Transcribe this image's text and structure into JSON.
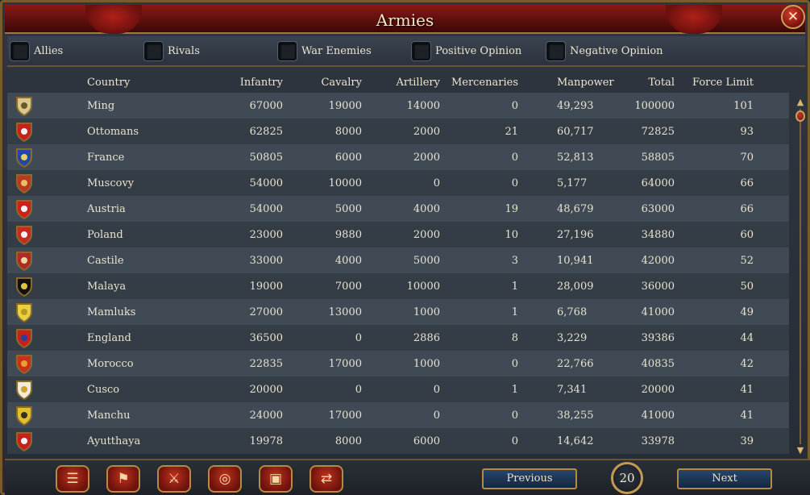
{
  "window": {
    "title": "Armies",
    "close_label": "✕"
  },
  "filters": [
    {
      "label": "Allies"
    },
    {
      "label": "Rivals"
    },
    {
      "label": "War Enemies"
    },
    {
      "label": "Positive Opinion"
    },
    {
      "label": "Negative Opinion"
    }
  ],
  "columns": [
    "Country",
    "Infantry",
    "Cavalry",
    "Artillery",
    "Mercenaries",
    "Manpower",
    "Total",
    "Force Limit"
  ],
  "rows": [
    {
      "country": "Ming",
      "infantry": "67000",
      "cavalry": "19000",
      "artillery": "14000",
      "mercenaries": "0",
      "manpower": "49,293",
      "total": "100000",
      "force_limit": "101",
      "flag": [
        "#d8c890",
        "#6a5a2a"
      ]
    },
    {
      "country": "Ottomans",
      "infantry": "62825",
      "cavalry": "8000",
      "artillery": "2000",
      "mercenaries": "21",
      "manpower": "60,717",
      "total": "72825",
      "force_limit": "93",
      "flag": [
        "#c8201c",
        "#f0f0f0"
      ]
    },
    {
      "country": "France",
      "infantry": "50805",
      "cavalry": "6000",
      "artillery": "2000",
      "mercenaries": "0",
      "manpower": "52,813",
      "total": "58805",
      "force_limit": "70",
      "flag": [
        "#2446a8",
        "#e8d060"
      ]
    },
    {
      "country": "Muscovy",
      "infantry": "54000",
      "cavalry": "10000",
      "artillery": "0",
      "mercenaries": "0",
      "manpower": "5,177",
      "total": "64000",
      "force_limit": "66",
      "flag": [
        "#b83a22",
        "#e8c060"
      ]
    },
    {
      "country": "Austria",
      "infantry": "54000",
      "cavalry": "5000",
      "artillery": "4000",
      "mercenaries": "19",
      "manpower": "48,679",
      "total": "63000",
      "force_limit": "66",
      "flag": [
        "#d0201c",
        "#f4f4f4"
      ]
    },
    {
      "country": "Poland",
      "infantry": "23000",
      "cavalry": "9880",
      "artillery": "2000",
      "mercenaries": "10",
      "manpower": "27,196",
      "total": "34880",
      "force_limit": "60",
      "flag": [
        "#c82a22",
        "#f4f4f4"
      ]
    },
    {
      "country": "Castile",
      "infantry": "33000",
      "cavalry": "4000",
      "artillery": "5000",
      "mercenaries": "3",
      "manpower": "10,941",
      "total": "42000",
      "force_limit": "52",
      "flag": [
        "#b02a2a",
        "#e8d8a0"
      ]
    },
    {
      "country": "Malaya",
      "infantry": "19000",
      "cavalry": "7000",
      "artillery": "10000",
      "mercenaries": "1",
      "manpower": "28,009",
      "total": "36000",
      "force_limit": "50",
      "flag": [
        "#111111",
        "#e0c040"
      ]
    },
    {
      "country": "Mamluks",
      "infantry": "27000",
      "cavalry": "13000",
      "artillery": "1000",
      "mercenaries": "1",
      "manpower": "6,768",
      "total": "41000",
      "force_limit": "49",
      "flag": [
        "#e8d040",
        "#b89820"
      ]
    },
    {
      "country": "England",
      "infantry": "36500",
      "cavalry": "0",
      "artillery": "2886",
      "mercenaries": "8",
      "manpower": "3,229",
      "total": "39386",
      "force_limit": "44",
      "flag": [
        "#c8201c",
        "#2a3e9a"
      ]
    },
    {
      "country": "Morocco",
      "infantry": "22835",
      "cavalry": "17000",
      "artillery": "1000",
      "mercenaries": "0",
      "manpower": "22,766",
      "total": "40835",
      "force_limit": "42",
      "flag": [
        "#c8301c",
        "#e8a030"
      ]
    },
    {
      "country": "Cusco",
      "infantry": "20000",
      "cavalry": "0",
      "artillery": "0",
      "mercenaries": "1",
      "manpower": "7,341",
      "total": "20000",
      "force_limit": "41",
      "flag": [
        "#f0ecd8",
        "#d0a030"
      ]
    },
    {
      "country": "Manchu",
      "infantry": "24000",
      "cavalry": "17000",
      "artillery": "0",
      "mercenaries": "0",
      "manpower": "38,255",
      "total": "41000",
      "force_limit": "41",
      "flag": [
        "#e0c030",
        "#3a3020"
      ]
    },
    {
      "country": "Ayutthaya",
      "infantry": "19978",
      "cavalry": "8000",
      "artillery": "6000",
      "mercenaries": "0",
      "manpower": "14,642",
      "total": "33978",
      "force_limit": "39",
      "flag": [
        "#c8201c",
        "#f4f4f4"
      ]
    }
  ],
  "bottom": {
    "tool_buttons": [
      {
        "icon": "ledger-icon",
        "glyph": "☰"
      },
      {
        "icon": "flags-icon",
        "glyph": "⚑"
      },
      {
        "icon": "crossed-swords-icon",
        "glyph": "⚔"
      },
      {
        "icon": "coins-icon",
        "glyph": "◎"
      },
      {
        "icon": "trade-goods-icon",
        "glyph": "▣"
      },
      {
        "icon": "handshake-icon",
        "glyph": "⇄"
      }
    ],
    "previous_label": "Previous",
    "next_label": "Next",
    "page": "20"
  },
  "scrollbar": {
    "up": "▲",
    "down": "▼"
  }
}
